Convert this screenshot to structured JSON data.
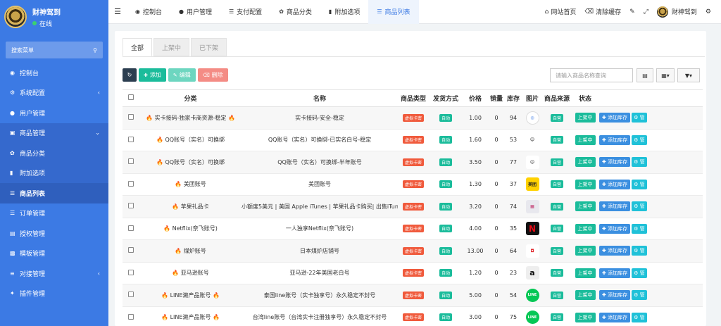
{
  "sidebar": {
    "profile": {
      "name": "财神驾到",
      "status": "在线"
    },
    "search_placeholder": "搜索菜单",
    "items": [
      {
        "label": "控制台",
        "icon": "dashboard-icon"
      },
      {
        "label": "系统配置",
        "icon": "gear-icon"
      },
      {
        "label": "用户管理",
        "icon": "user-icon"
      },
      {
        "label": "商品管理",
        "icon": "cart-icon"
      },
      {
        "label": "商品分类",
        "icon": "leaf-icon"
      },
      {
        "label": "附加选项",
        "icon": "bookmark-icon"
      },
      {
        "label": "商品列表",
        "icon": "list-icon"
      },
      {
        "label": "订单管理",
        "icon": "list-icon"
      },
      {
        "label": "授权管理",
        "icon": "file-icon"
      },
      {
        "label": "模板管理",
        "icon": "template-icon"
      },
      {
        "label": "对接管理",
        "icon": "sliders-icon"
      },
      {
        "label": "插件管理",
        "icon": "plug-icon"
      }
    ]
  },
  "topbar": {
    "nav": [
      {
        "label": "控制台"
      },
      {
        "label": "用户管理"
      },
      {
        "label": "支付配置"
      },
      {
        "label": "商品分类"
      },
      {
        "label": "附加选项"
      },
      {
        "label": "商品列表"
      }
    ],
    "right": {
      "home": "网站首页",
      "clear": "清除缓存",
      "user": "财神驾到"
    }
  },
  "tabs": [
    "全部",
    "上架中",
    "已下架"
  ],
  "toolbar": {
    "add": "添加",
    "edit": "编辑",
    "delete": "删除"
  },
  "search_placeholder": "请输入商品名称查询",
  "table": {
    "headers": [
      "分类",
      "名称",
      "商品类型",
      "发货方式",
      "价格",
      "销量",
      "库存",
      "图片",
      "商品来源",
      "状态"
    ],
    "type_tag": "虚拟卡密",
    "ship_tag": "自动",
    "source_tag": "自营",
    "status_tag": "上架中",
    "action_label": "添加库存",
    "rows": [
      {
        "category": "实卡接码-独家卡商资源-稳定",
        "fire_left": true,
        "fire_right": true,
        "name": "实卡接码-安全-稳定",
        "price": "1.00",
        "sales": "0",
        "stock": "94",
        "img": "generic"
      },
      {
        "category": "QQ账号（实名）可换绑",
        "fire_left": true,
        "fire_right": false,
        "name": "QQ账号（实名）可换绑-已实名白号-稳定",
        "price": "1.60",
        "sales": "0",
        "stock": "53",
        "img": "qq"
      },
      {
        "category": "QQ账号（实名）可换绑",
        "fire_left": true,
        "fire_right": false,
        "name": "QQ账号（实名）可换绑-半年账号",
        "price": "3.50",
        "sales": "0",
        "stock": "77",
        "img": "qq"
      },
      {
        "category": "美团账号",
        "fire_left": true,
        "fire_right": false,
        "name": "美团账号",
        "price": "1.30",
        "sales": "0",
        "stock": "37",
        "img": "meituan",
        "img_text": "美团"
      },
      {
        "category": "苹果礼品卡",
        "fire_left": true,
        "fire_right": false,
        "name": "小额度5美元 | 美国 Apple iTunes | 苹果礼品卡购买| 出售iTunes礼品卡|",
        "price": "3.20",
        "sales": "0",
        "stock": "74",
        "img": "apple"
      },
      {
        "category": "Netflix(奈飞账号)",
        "fire_left": true,
        "fire_right": false,
        "name": "一人独享Netflix(奈飞账号)",
        "price": "4.00",
        "sales": "0",
        "stock": "35",
        "img": "netflix",
        "img_text": "N"
      },
      {
        "category": "煤炉账号",
        "fire_left": true,
        "fire_right": false,
        "name": "日本煤炉店铺号",
        "price": "13.00",
        "sales": "0",
        "stock": "64",
        "img": "mercari"
      },
      {
        "category": "亚马逊账号",
        "fire_left": true,
        "fire_right": false,
        "name": "亚马逊-22年美国老白号",
        "price": "1.20",
        "sales": "0",
        "stock": "23",
        "img": "amazon",
        "img_text": "a"
      },
      {
        "category": "LINE濑产品账号",
        "fire_left": true,
        "fire_right": true,
        "name": "泰国line账号（实卡独享号）永久稳定不封号",
        "price": "5.00",
        "sales": "0",
        "stock": "54",
        "img": "line",
        "img_text": "LINE"
      },
      {
        "category": "LINE濑产品账号",
        "fire_left": true,
        "fire_right": true,
        "name": "台湾line账号（台湾实卡注册独享号）永久稳定不封号",
        "price": "3.00",
        "sales": "0",
        "stock": "75",
        "img": "line",
        "img_text": "LINE"
      }
    ]
  },
  "colors": {
    "sidebar": "#3c7ae4",
    "accent": "#3c7ae4",
    "tag_red": "#f05a3c",
    "tag_green": "#1bbc9b"
  }
}
